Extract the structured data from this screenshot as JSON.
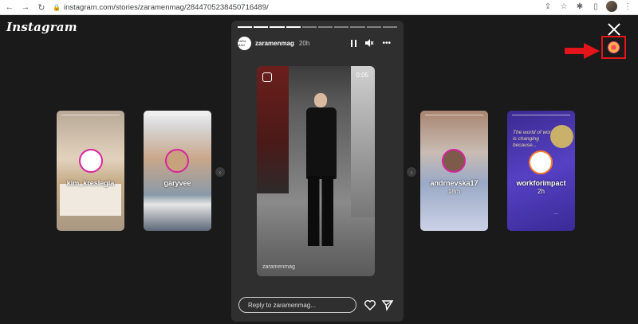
{
  "browser": {
    "url": "instagram.com/stories/zaramenmag/2844705238450716489/"
  },
  "app": {
    "logo_text": "Instagram"
  },
  "side_stories": [
    {
      "name": "kim_kreslegia",
      "time": ""
    },
    {
      "name": "garyvee",
      "time": ""
    },
    {
      "name": "andrnevska17",
      "time": "18m"
    },
    {
      "name": "workforimpact",
      "time": "2h"
    }
  ],
  "side_story_details": {
    "s4_headline": "The world of work is changing because...",
    "s4_tag": "…"
  },
  "main_story": {
    "username": "zaramenmag",
    "avatar_text": "ZARA MAN",
    "time": "20h",
    "video_time": "0:05",
    "watermark": "zaramenmag",
    "reply_placeholder": "Reply to zaramenmag..."
  },
  "colors": {
    "annotation": "#e3151a",
    "story_ring": "#d6249f"
  }
}
